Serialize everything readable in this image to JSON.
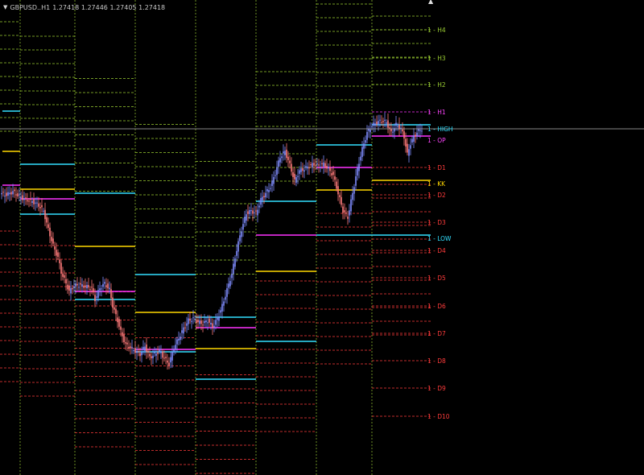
{
  "header": {
    "symbol": "GBPUSD..H1",
    "quotes": "1.27418 1.27446 1.27405 1.27418",
    "menu_icon": "triangle-down-icon"
  },
  "scroll_marker": "▲",
  "chart_data": {
    "type": "candlestick",
    "symbol": "GBPUSD",
    "timeframe": "H1",
    "ohlc_header": {
      "open": 1.27418,
      "high": 1.27446,
      "low": 1.27405,
      "close": 1.27418
    },
    "colors": {
      "background": "#000000",
      "bull_candle": "#7f8cff",
      "bear_candle": "#ff7a7a",
      "upper_levels": "#9acd32",
      "lower_levels": "#ff3b3b",
      "pivot_magenta": "#ff33ff",
      "high_low_cyan": "#33e0ff",
      "kk_yellow": "#ffd700",
      "session_separator": "#9acd32",
      "current_price_line": "#b4b4b4"
    },
    "level_labels": [
      {
        "text": "1 - H4",
        "color": "#9acd32"
      },
      {
        "text": "1 - H3",
        "color": "#9acd32"
      },
      {
        "text": "1 - H2",
        "color": "#9acd32"
      },
      {
        "text": "1 - H1",
        "color": "#ff44ff"
      },
      {
        "text": "1 - HIGH",
        "color": "#33e0ff"
      },
      {
        "text": "1 - OP",
        "color": "#ff44ff"
      },
      {
        "text": "1 - D1",
        "color": "#ff3b3b"
      },
      {
        "text": "1 - KK",
        "color": "#ffd700"
      },
      {
        "text": "1 - D2",
        "color": "#ff3b3b"
      },
      {
        "text": "1 - D3",
        "color": "#ff3b3b"
      },
      {
        "text": "1 - LOW",
        "color": "#33e0ff"
      },
      {
        "text": "1 - D4",
        "color": "#ff3b3b"
      },
      {
        "text": "1 - D5",
        "color": "#ff3b3b"
      },
      {
        "text": "1 - D6",
        "color": "#ff3b3b"
      },
      {
        "text": "1 - D7",
        "color": "#ff3b3b"
      },
      {
        "text": "1 - D8",
        "color": "#ff3b3b"
      },
      {
        "text": "1 - D9",
        "color": "#ff3b3b"
      },
      {
        "text": "1 - D10",
        "color": "#ff3b3b"
      }
    ]
  }
}
